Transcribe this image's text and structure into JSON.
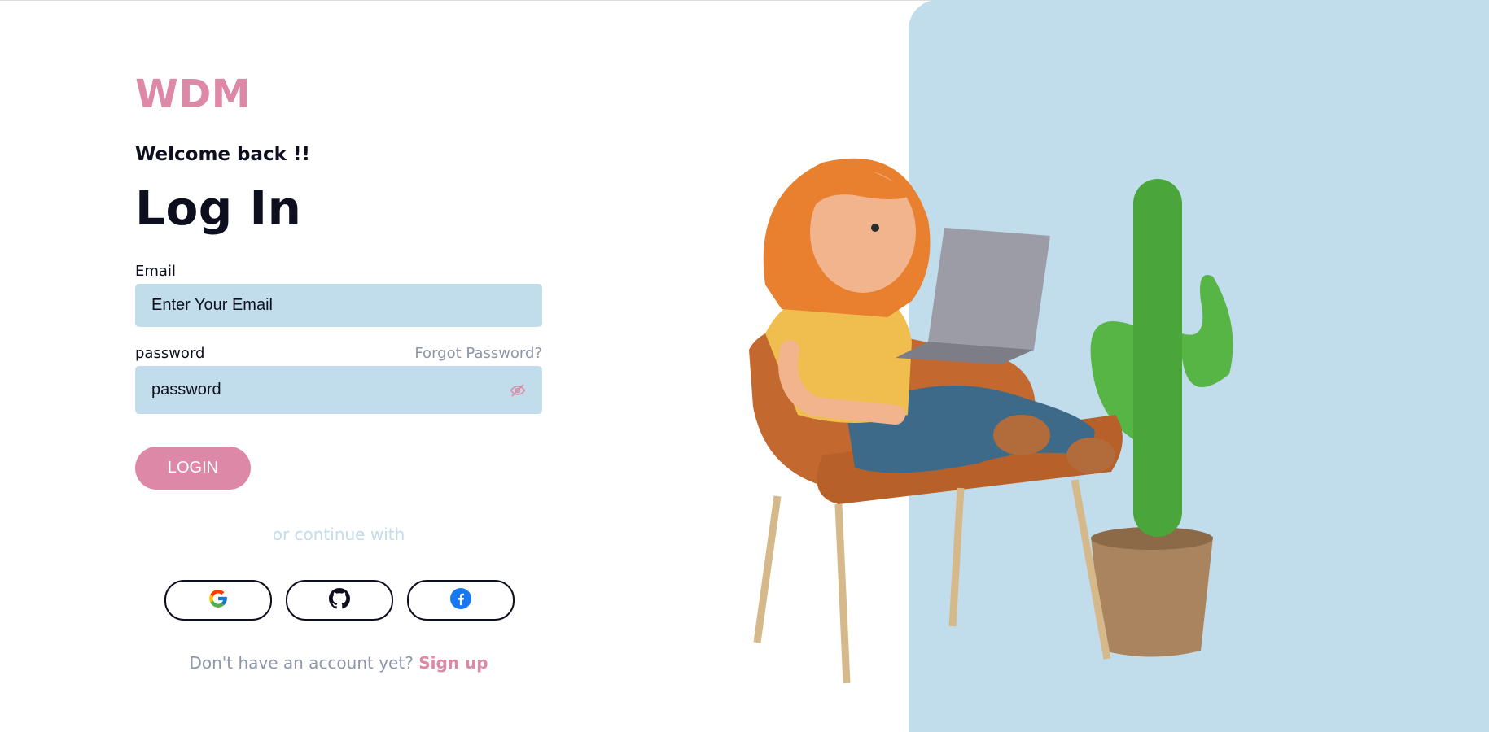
{
  "brand": "WDM",
  "welcome": "Welcome back !!",
  "title": "Log In",
  "email": {
    "label": "Email",
    "placeholder": "Enter Your Email",
    "value": ""
  },
  "password": {
    "label": "password",
    "placeholder": "password",
    "value": "",
    "forgot_label": "Forgot Password?",
    "toggle_icon": "eye-off-icon"
  },
  "login_label": "LOGIN",
  "divider_text": "or continue with",
  "social": [
    {
      "name": "Google",
      "icon": "google-icon"
    },
    {
      "name": "GitHub",
      "icon": "github-icon"
    },
    {
      "name": "Facebook",
      "icon": "facebook-icon"
    }
  ],
  "signup": {
    "prompt": "Don't have an account yet?",
    "link": "Sign up"
  },
  "colors": {
    "accent": "#dc88a6",
    "input_bg": "#c1dcea",
    "panel_bg": "#c1dcea",
    "text": "#0d0f1f",
    "muted": "#8d96a8"
  }
}
